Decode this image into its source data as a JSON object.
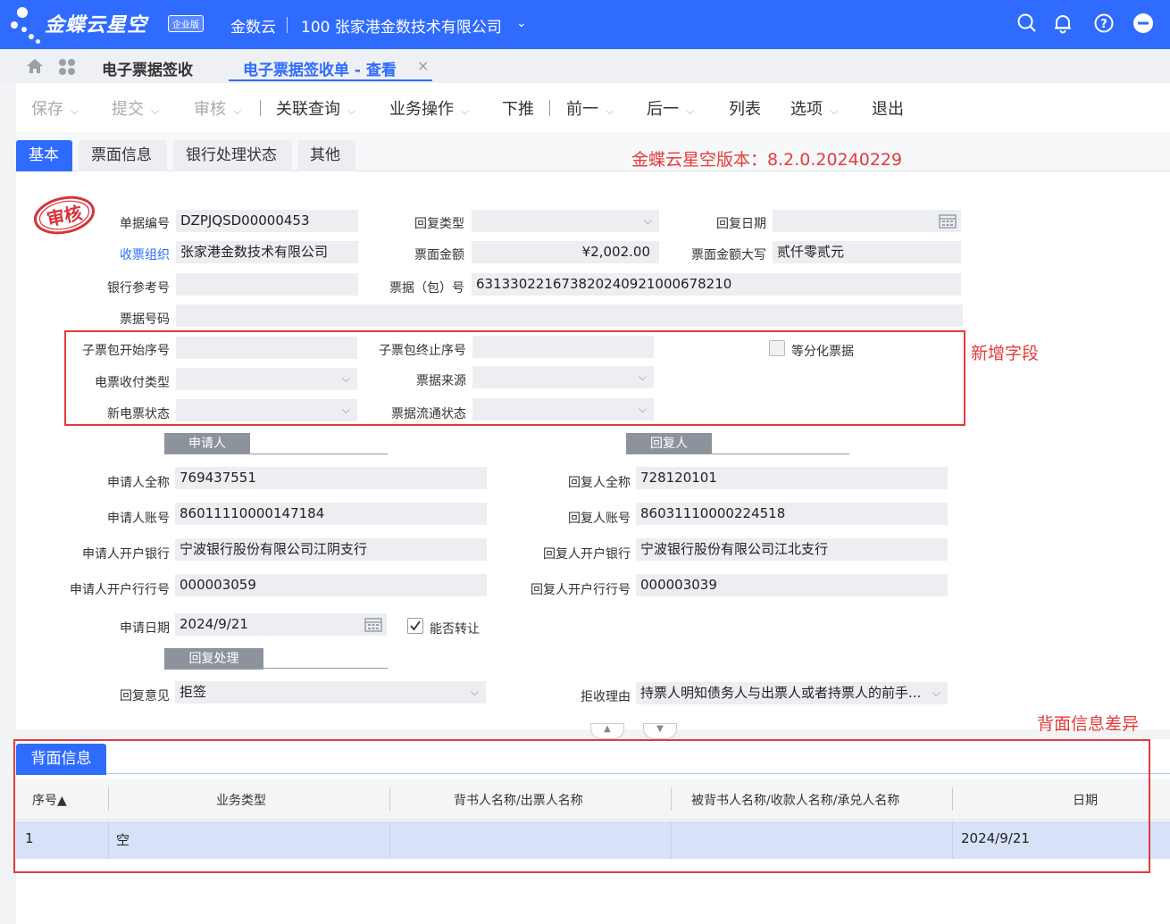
{
  "topbar": {
    "brand": "金蝶云星空",
    "edition": "企业版",
    "product": "金数云",
    "company": "100 张家港金数技术有限公司"
  },
  "tabs": {
    "list_tab": "电子票据签收",
    "active_tab": "电子票据签收单 - 查看"
  },
  "toolbar": {
    "save": "保存",
    "submit": "提交",
    "audit": "审核",
    "related_query": "关联查询",
    "business_ops": "业务操作",
    "push_down": "下推",
    "prev": "前一",
    "next": "后一",
    "list": "列表",
    "options": "选项",
    "exit": "退出"
  },
  "form_tabs": {
    "basic": "基本",
    "face_info": "票面信息",
    "bank_status": "银行处理状态",
    "other": "其他"
  },
  "version_note": "金蝶云星空版本：8.2.0.20240229",
  "stamp_text": "审核",
  "fields": {
    "bill_no": {
      "label": "单据编号",
      "value": "DZPJQSD00000453"
    },
    "reply_type": {
      "label": "回复类型",
      "value": ""
    },
    "reply_date": {
      "label": "回复日期",
      "value": ""
    },
    "recv_org": {
      "label": "收票组织",
      "value": "张家港金数技术有限公司"
    },
    "face_amount": {
      "label": "票面金额",
      "value": "¥2,002.00"
    },
    "face_amount_upper": {
      "label": "票面金额大写",
      "value": "贰仟零贰元"
    },
    "bank_ref": {
      "label": "银行参考号",
      "value": ""
    },
    "bill_pkg_no": {
      "label": "票据（包）号",
      "value": "631330221673820240921000678210"
    },
    "bill_code": {
      "label": "票据号码",
      "value": ""
    },
    "sub_start": {
      "label": "子票包开始序号",
      "value": ""
    },
    "sub_end": {
      "label": "子票包终止序号",
      "value": ""
    },
    "equal_split": {
      "label": "等分化票据"
    },
    "pay_type": {
      "label": "电票收付类型",
      "value": ""
    },
    "bill_source": {
      "label": "票据来源",
      "value": ""
    },
    "new_status": {
      "label": "新电票状态",
      "value": ""
    },
    "circ_status": {
      "label": "票据流通状态",
      "value": ""
    }
  },
  "new_fields_note": "新增字段",
  "applicant": {
    "section": "申请人",
    "name_label": "申请人全称",
    "name": "769437551",
    "account_label": "申请人账号",
    "account": "86011110000147184",
    "bank_label": "申请人开户银行",
    "bank": "宁波银行股份有限公司江阴支行",
    "bank_no_label": "申请人开户行行号",
    "bank_no": "000003059",
    "date_label": "申请日期",
    "date": "2024/9/21",
    "transferable_label": "能否转让"
  },
  "replier": {
    "section": "回复人",
    "name_label": "回复人全称",
    "name": "728120101",
    "account_label": "回复人账号",
    "account": "86031110000224518",
    "bank_label": "回复人开户银行",
    "bank": "宁波银行股份有限公司江北支行",
    "bank_no_label": "回复人开户行行号",
    "bank_no": "000003039"
  },
  "reply_process": {
    "section": "回复处理",
    "opinion_label": "回复意见",
    "opinion": "拒签",
    "reason_label": "拒收理由",
    "reason": "持票人明知债务人与出票人或者持票人的前手..."
  },
  "back_diff_note": "背面信息差异",
  "back_info": {
    "tab": "背面信息",
    "columns": [
      "序号▲",
      "业务类型",
      "背书人名称/出票人名称",
      "被背书人名称/收款人名称/承兑人名称",
      "日期"
    ],
    "rows": [
      {
        "seq": "1",
        "type": "空",
        "endorser": "",
        "endorsee": "",
        "date": "2024/9/21"
      }
    ]
  }
}
